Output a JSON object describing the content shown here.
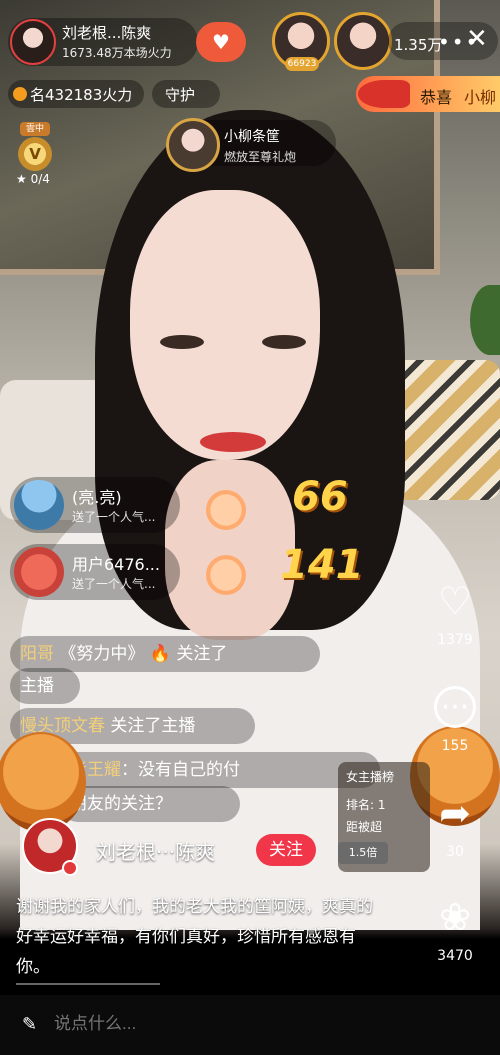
{
  "header": {
    "host_name": "刘老根...陈爽",
    "host_fire": "1673.48万本场火力",
    "rank_avatar_badge_1": "",
    "viewer_count": "1.35万",
    "more_icon": "more-dots-icon",
    "close_icon": "close-icon"
  },
  "status": {
    "rank_text": "名432183火力",
    "guard_text": "守护",
    "level_tag": "雲中",
    "level_letter": "V",
    "level_progress": "★ 0/4"
  },
  "banner": {
    "congrats_text": "恭喜",
    "congrats_name": "小柳"
  },
  "gift_notice": {
    "name": "小柳条筐",
    "desc": "燃放至尊礼炮"
  },
  "comments": [
    {
      "name": "(亮.亮)",
      "sub": "送了一个人气...",
      "combo": "66"
    },
    {
      "name": "用户6476...",
      "sub": "送了一个人气...",
      "combo": "141"
    }
  ],
  "messages": [
    {
      "user": "阳哥",
      "text": "《努力中》 🔥 关注了"
    },
    {
      "user": "",
      "text": "主播"
    },
    {
      "user": "慢头顶文春",
      "text": "关注了主播"
    },
    {
      "user": "者王耀",
      "text": "：没有自己的付"
    },
    {
      "user": "",
      "text": "朋友的关注？"
    }
  ],
  "rank_card": {
    "title": "女主播榜",
    "pos": "排名: 1",
    "gap": "距被超",
    "multiplier": "1.5倍"
  },
  "actions": {
    "like_count": "1379",
    "comment_count": "155",
    "share_count": "30",
    "gift_count": "3470"
  },
  "author": {
    "name": "刘老根···陈爽",
    "follow_label": "关注"
  },
  "caption": "谢谢我的家人们，我的老大我的筐阿姨，爽真的好幸运好幸福，有你们真好，珍惜所有感恩有你。",
  "comment_bar": {
    "placeholder": "说点什么..."
  }
}
